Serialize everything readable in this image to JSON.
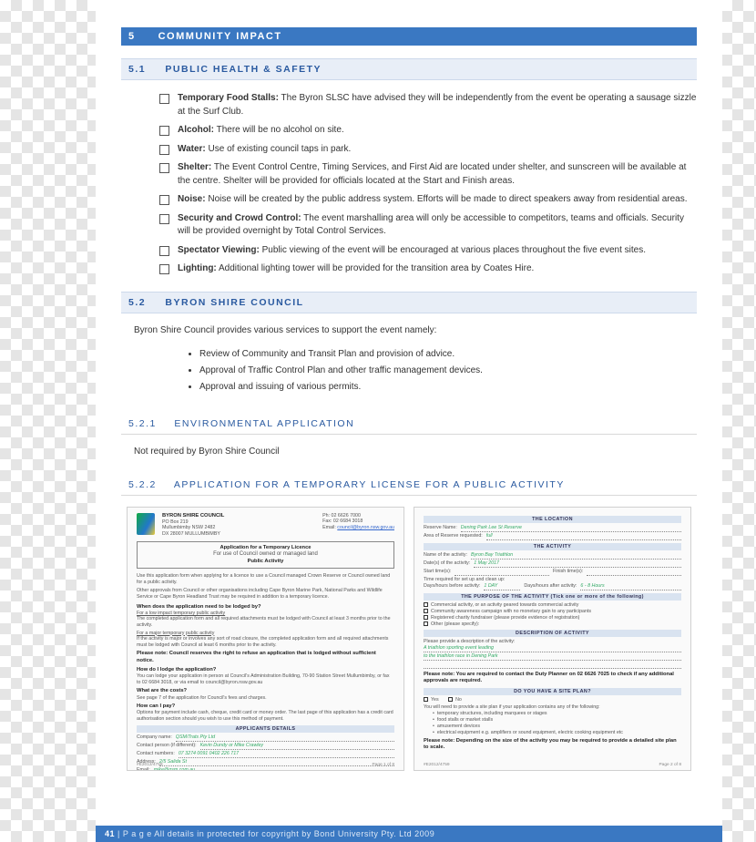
{
  "section": {
    "num": "5",
    "title": "COMMUNITY IMPACT"
  },
  "sub_5_1": {
    "num": "5.1",
    "title": "PUBLIC HEALTH & SAFETY"
  },
  "checklist": [
    {
      "label": "Temporary Food Stalls:",
      "text": " The Byron SLSC have advised they will be independently from the event be operating a sausage sizzle at the Surf Club."
    },
    {
      "label": "Alcohol:",
      "text": " There will be no alcohol on site."
    },
    {
      "label": "Water:",
      "text": "  Use of existing council taps in park."
    },
    {
      "label": "Shelter:",
      "text": " The Event Control Centre, Timing Services, and First Aid are located under shelter, and sunscreen will be available at the centre. Shelter will be provided for officials located at the Start and Finish areas."
    },
    {
      "label": "Noise:",
      "text": " Noise will be created by the public address system. Efforts will be made to direct speakers away from residential areas."
    },
    {
      "label": "Security and Crowd Control:",
      "text": " The event marshalling area will only be accessible to competitors, teams and officials. Security will be provided overnight by Total Control Services."
    },
    {
      "label": "Spectator Viewing:",
      "text": " Public viewing of the event will be encouraged at various places throughout the five event sites."
    },
    {
      "label": "Lighting:",
      "text": " Additional lighting tower will be provided for the transition area by Coates Hire."
    }
  ],
  "sub_5_2": {
    "num": "5.2",
    "title": "BYRON SHIRE COUNCIL"
  },
  "para_5_2": "Byron Shire Council provides various services to support the event namely:",
  "bullets_5_2": [
    "Review of Community and Transit Plan and provision of advice.",
    "Approval of Traffic Control Plan and other traffic management devices.",
    "Approval and issuing of various permits."
  ],
  "sub_5_2_1": {
    "num": "5.2.1",
    "title": "ENVIRONMENTAL APPLICATION"
  },
  "para_5_2_1": "Not required by Byron Shire Council",
  "sub_5_2_2": {
    "num": "5.2.2",
    "title": "APPLICATION FOR A TEMPORARY LICENSE FOR A PUBLIC ACTIVITY"
  },
  "form_left": {
    "org_name": "BYRON SHIRE COUNCIL",
    "org_addr1": "PO Box 219",
    "org_addr2": "Mullumbimby NSW 2482",
    "org_dx": "DX 28007 MULLUMBIMBY",
    "ph_lbl": "Ph:",
    "ph": "02 6626 7000",
    "fax_lbl": "Fax:",
    "fax": "02 6684 3018",
    "email_lbl": "Email:",
    "email": "council@byron.nsw.gov.au",
    "title_l1": "Application for a Temporary Licence",
    "title_l2": "For use of Council owned or managed land",
    "title_l3": "Public Activity",
    "intro": "Use this application form when applying for a licence to use a Council managed Crown Reserve or Council owned land for a public activity.",
    "intro2": "Other approvals from Council or other organisations including Cape Byron Marine Park, National Parks and Wildlife Service or Cape Byron Headland Trust may be required in addition to a temporary licence.",
    "q1": "When does the application need to be lodged by?",
    "q1_a": "For a low impact temporary public activity",
    "q1_b": "The completed application form and all required attachments must be lodged with Council at least 3 months prior to the activity.",
    "q1_c": "For a major temporary public activity",
    "q1_d": "If the activity is major or involves any sort of road closure, the completed application form and all required attachments must be lodged with Council at least 6 months prior to the activity.",
    "note": "Please note: Council reserves the right to refuse an application that is lodged without sufficient notice.",
    "q2": "How do I lodge the application?",
    "q2_a": "You can lodge your application in person at Council's Administration Building, 70-90 Station Street Mullumbimby, or fax to 02 6684 3018, or via email to council@byron.nsw.gov.au",
    "q3": "What are the costs?",
    "q3_a": "See page 7 of the application for Council's fees and charges.",
    "q4": "How can I pay?",
    "q4_a": "Options for payment include cash, cheque, credit card or money order. The last page of this application has a credit card authorisation section should you wish to use this method of payment.",
    "sect_app": "APPLICANTS DETAILS",
    "f_company_l": "Company name:",
    "f_company_v": "QSM/Trats Pty Ltd",
    "f_contact_l": "Contact person (if different):",
    "f_contact_v": "Kevin Dundy or Mike Crawley",
    "f_phone_l": "Contact numbers:",
    "f_phone_v": "07 3274 0091     0402 226 717",
    "f_addr_l": "Address:",
    "f_addr_v": "2/5 Salida St",
    "f_email_l": "Email:",
    "f_email_v": "mike@qsm.com.au",
    "foot_ref": "#E2012/4759",
    "foot_page": "Page 1 of 8"
  },
  "form_right": {
    "sect_loc": "THE LOCATION",
    "f_reserve_l": "Reserve Name:",
    "f_reserve_v": "Dening Park   Lee St Reserve",
    "f_area_l": "Area of Reserve requested:",
    "f_area_v": "full",
    "sect_act": "THE ACTIVITY",
    "f_name_l": "Name of the activity:",
    "f_name_v": "Byron Bay Triathlon",
    "f_dates_l": "Date(s) of the activity:",
    "f_dates_v": "1 May 2017",
    "f_start_l": "Start time(s):",
    "f_start_v": "",
    "f_finish_l": "Finish time(s):",
    "f_finish_v": "",
    "f_setup_l": "Time required for set up and clean up:",
    "f_before_l": "Days/hours before activity:",
    "f_before_v": "1 DAY",
    "f_after_l": "Days/hours after activity:",
    "f_after_v": "6 - 8 Hours",
    "sect_purpose": "THE PURPOSE OF THE ACTIVITY (Tick one or more of the following)",
    "purpose_opts": [
      "Commercial activity, or an activity geared towards commercial activity",
      "Community awareness campaign with no monetary gain to any participants",
      "Registered charity fundraiser (please provide evidence of registration)",
      "Other (please specify):"
    ],
    "sect_desc": "DESCRIPTION OF ACTIVITY",
    "desc_l": "Please provide a description of the activity:",
    "desc_v1": "A triathlon sporting event leading",
    "desc_v2": "to the triathlon race in Dening Park",
    "note2": "Please note: You are required to contact the Duty Planner on 02 6626 7025 to check if any additional approvals are required.",
    "sect_site": "DO YOU HAVE A SITE PLAN?",
    "site_yes": "Yes",
    "site_no": "No",
    "site_txt": "You will need to provide a site plan if your application contains any of the following:",
    "site_opts": [
      "temporary structures, including marquees or stages",
      "food stalls or market stalls",
      "amusement devices",
      "electrical equipment e.g. amplifiers or sound equipment, electric cooking equipment etc"
    ],
    "note3": "Please note: Depending on the size of the activity you may be required to provide a detailed site plan to scale.",
    "foot_ref": "#E2012/4759",
    "foot_page": "Page 2 of 8"
  },
  "footer": {
    "page_num": "41",
    "page_lbl": " | P a g e",
    "copyright": "   All details in protected for copyright by Bond University Pty. Ltd 2009"
  }
}
